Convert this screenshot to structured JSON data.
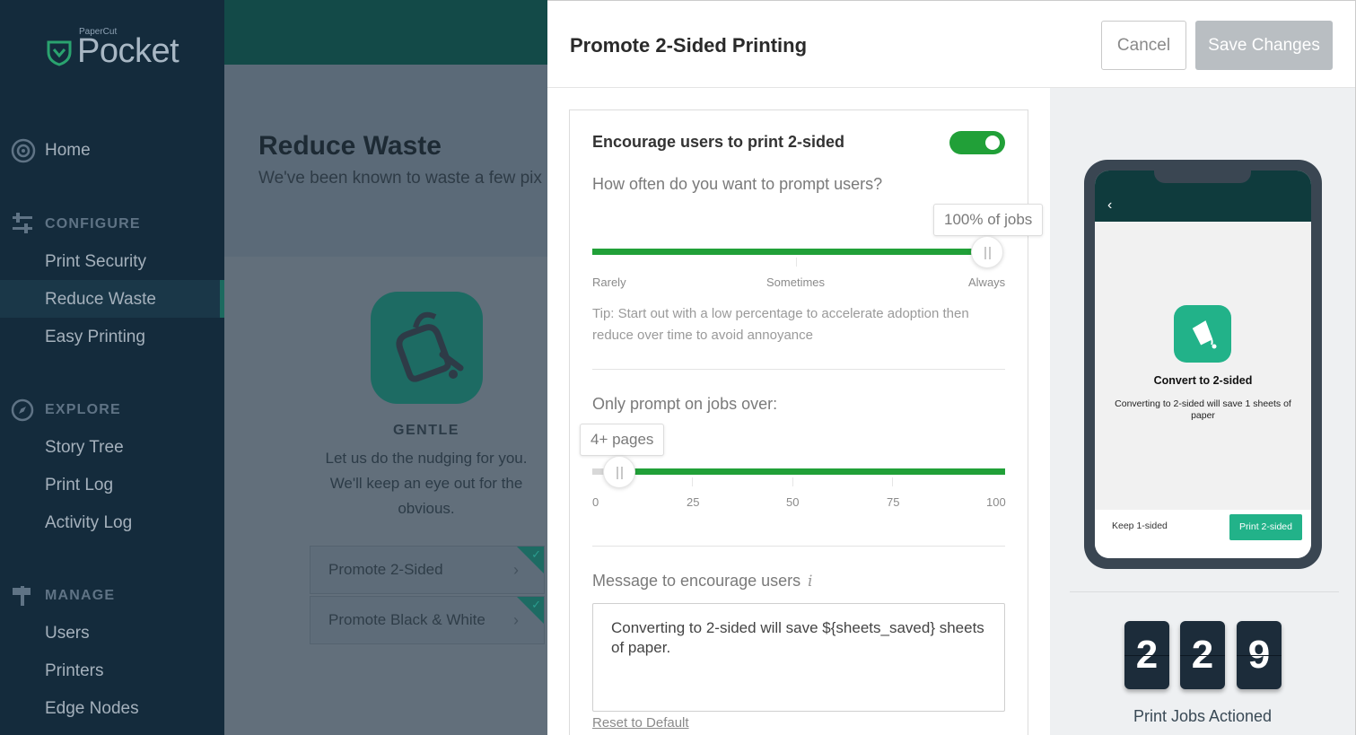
{
  "sidebar": {
    "brand_small": "PaperCut",
    "brand": "Pocket",
    "home": "Home",
    "configure_title": "CONFIGURE",
    "configure_items": [
      "Print Security",
      "Reduce Waste",
      "Easy Printing"
    ],
    "explore_title": "EXPLORE",
    "explore_items": [
      "Story Tree",
      "Print Log",
      "Activity Log"
    ],
    "manage_title": "MANAGE",
    "manage_items": [
      "Users",
      "Printers",
      "Edge Nodes"
    ],
    "active_item": "Reduce Waste"
  },
  "main": {
    "title": "Reduce Waste",
    "subtitle": "We've been known to waste a few pix",
    "tile_label": "GENTLE",
    "tile_desc": "Let us do the nudging for you. We'll keep an eye out for the obvious.",
    "cards": [
      "Promote 2-Sided",
      "Promote Black & White"
    ]
  },
  "drawer": {
    "title": "Promote 2-Sided Printing",
    "cancel_label": "Cancel",
    "save_label": "Save Changes",
    "encourage_label": "Encourage users to print 2-sided",
    "encourage_enabled": true,
    "frequency_question": "How often do you want to prompt users?",
    "frequency_tooltip": "100% of jobs",
    "frequency_value_percent": 100,
    "frequency_ticks": [
      "Rarely",
      "Sometimes",
      "Always"
    ],
    "tip": "Tip: Start out with a low percentage to accelerate adoption then reduce over time to avoid annoyance",
    "pages_question": "Only prompt on jobs over:",
    "pages_tooltip": "4+ pages",
    "pages_value": 4,
    "pages_ticks": [
      "0",
      "25",
      "50",
      "75",
      "100"
    ],
    "message_label": "Message to encourage users",
    "message_value": "Converting to 2-sided will save ${sheets_saved} sheets of paper.",
    "reset_label": "Reset to Default"
  },
  "preview": {
    "back": "‹",
    "convert_title": "Convert to 2-sided",
    "convert_desc": "Converting to 2-sided will save 1 sheets of paper",
    "keep_label": "Keep 1-sided",
    "print_label": "Print 2-sided",
    "counter_digits": [
      "2",
      "2",
      "9"
    ],
    "counter_label": "Print Jobs Actioned"
  },
  "colors": {
    "sidebar_bg": "#142b3c",
    "accent_green": "#21a038",
    "teal": "#1d6b63",
    "phone_green": "#22b289"
  }
}
